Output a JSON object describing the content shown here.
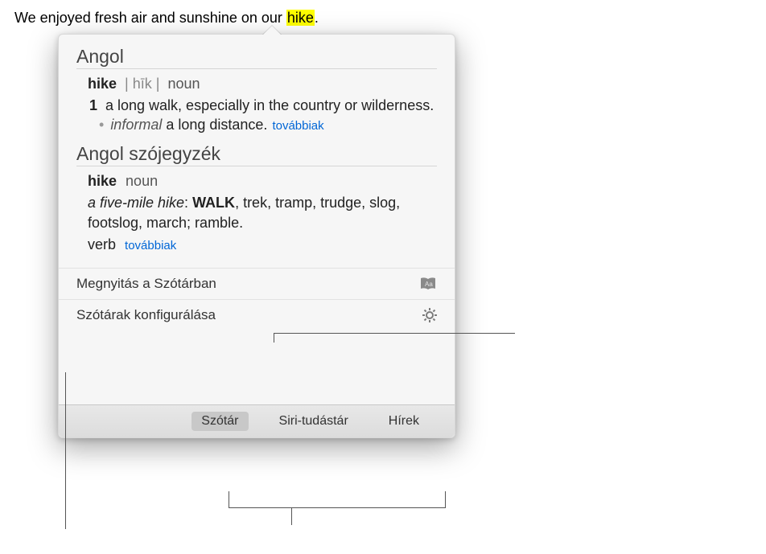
{
  "sentence": {
    "prefix": "We enjoyed fresh air and sunshine on our ",
    "highlight": "hike",
    "suffix": "."
  },
  "dictionary": {
    "title": "Angol",
    "word": "hike",
    "pronunciation": "| hīk |",
    "pos": "noun",
    "sense_num": "1",
    "sense_def": "a long walk, especially in the country or wilderness.",
    "sub_tag": "informal",
    "sub_def": "a long distance.",
    "more": "továbbiak"
  },
  "thesaurus": {
    "title": "Angol szójegyzék",
    "word": "hike",
    "pos": "noun",
    "example": "a five-mile hike",
    "primary": "WALK",
    "rest": ", trek, tramp, trudge, slog, footslog, march; ramble.",
    "verb_label": "verb",
    "more": "továbbiak"
  },
  "actions": {
    "open_in_dictionary": "Megnyitás a Szótárban",
    "configure": "Szótárak konfigurálása"
  },
  "tabs": {
    "dictionary": "Szótár",
    "siri": "Siri-tudástár",
    "news": "Hírek"
  }
}
